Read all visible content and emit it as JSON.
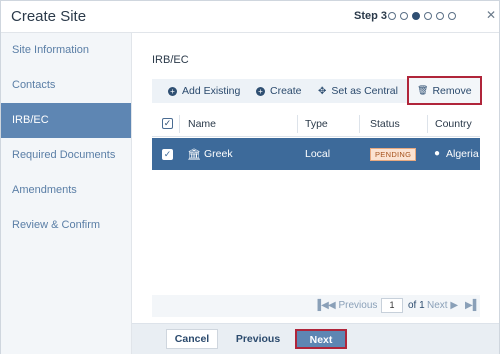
{
  "dialog": {
    "title": "Create Site",
    "step_label": "Step 3",
    "step_total": 6,
    "step_current": 3,
    "close_icon": "close-icon"
  },
  "sidebar": {
    "items": [
      {
        "label": "Site Information",
        "active": false
      },
      {
        "label": "Contacts",
        "active": false
      },
      {
        "label": "IRB/EC",
        "active": true
      },
      {
        "label": "Required Documents",
        "active": false
      },
      {
        "label": "Amendments",
        "active": false
      },
      {
        "label": "Review & Confirm",
        "active": false
      }
    ]
  },
  "main": {
    "section_title": "IRB/EC",
    "toolbar": {
      "add_existing": "Add Existing",
      "create": "Create",
      "set_central": "Set as Central",
      "remove": "Remove"
    },
    "table": {
      "columns": [
        "Name",
        "Type",
        "Status",
        "Country"
      ],
      "rows": [
        {
          "name": "Greek",
          "type": "Local",
          "status": "PENDING",
          "country": "Algeria",
          "selected": true
        }
      ]
    },
    "pager": {
      "previous": "Previous",
      "page": "1",
      "of_label": "of 1",
      "next": "Next"
    }
  },
  "footer": {
    "cancel": "Cancel",
    "previous": "Previous",
    "next": "Next"
  },
  "colors": {
    "accent": "#5e86b3",
    "selected_row": "#3d6a9a",
    "highlight_border": "#b0253a",
    "pending_badge_bg": "#fbe3d2"
  }
}
